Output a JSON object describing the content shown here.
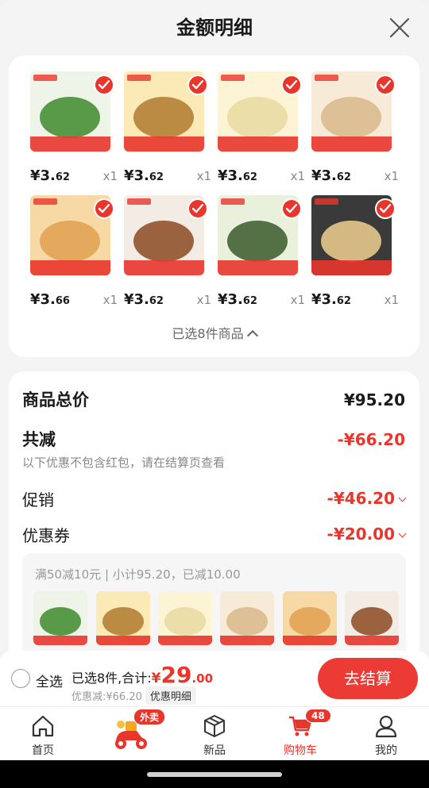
{
  "sheet": {
    "title": "金额明细"
  },
  "products": [
    {
      "price_main": "¥3.",
      "price_dec": "62",
      "qty": "x1",
      "colors": [
        "#eef4e8",
        "#3d8a2c"
      ]
    },
    {
      "price_main": "¥3.",
      "price_dec": "62",
      "qty": "x1",
      "colors": [
        "#fbe9b6",
        "#b07a2f"
      ]
    },
    {
      "price_main": "¥3.",
      "price_dec": "62",
      "qty": "x1",
      "colors": [
        "#fdf3d5",
        "#e8d9a0"
      ]
    },
    {
      "price_main": "¥3.",
      "price_dec": "62",
      "qty": "x1",
      "colors": [
        "#f7ead7",
        "#d8b88a"
      ]
    },
    {
      "price_main": "¥3.",
      "price_dec": "66",
      "qty": "x1",
      "colors": [
        "#f7d9a6",
        "#e0a050"
      ]
    },
    {
      "price_main": "¥3.",
      "price_dec": "62",
      "qty": "x1",
      "colors": [
        "#f3ece4",
        "#8a4a22"
      ]
    },
    {
      "price_main": "¥3.",
      "price_dec": "62",
      "qty": "x1",
      "colors": [
        "#e9f0dc",
        "#3a5a2a"
      ]
    },
    {
      "price_main": "¥3.",
      "price_dec": "62",
      "qty": "x1",
      "colors": [
        "#3a3a3a",
        "#f0d090"
      ]
    }
  ],
  "selected_toggle": "已选8件商品",
  "summary": {
    "total_label": "商品总价",
    "total_value": "¥95.20",
    "reduce_label": "共减",
    "reduce_value": "-¥66.20",
    "note": "以下优惠不包含红包，请在结算页查看",
    "promo_label": "促销",
    "promo_value": "-¥46.20",
    "coupon_label": "优惠券",
    "coupon_value": "-¥20.00",
    "coupon_detail": "满50减10元 | 小计95.20，已减10.00"
  },
  "bottom": {
    "select_all": "全选",
    "total_prefix": "已选8件,合计:",
    "currency": "¥",
    "amount": "29",
    "decimal": ".00",
    "discount": "优惠减:¥66.20",
    "detail_btn": "优惠明细",
    "checkout": "去结算"
  },
  "tabs": {
    "home": "首页",
    "takeout_badge": "外卖",
    "new": "新品",
    "cart": "购物车",
    "cart_badge": "48",
    "mine": "我的"
  },
  "colors": {
    "accent": "#e8362d",
    "checkout": "#ec3a34"
  }
}
